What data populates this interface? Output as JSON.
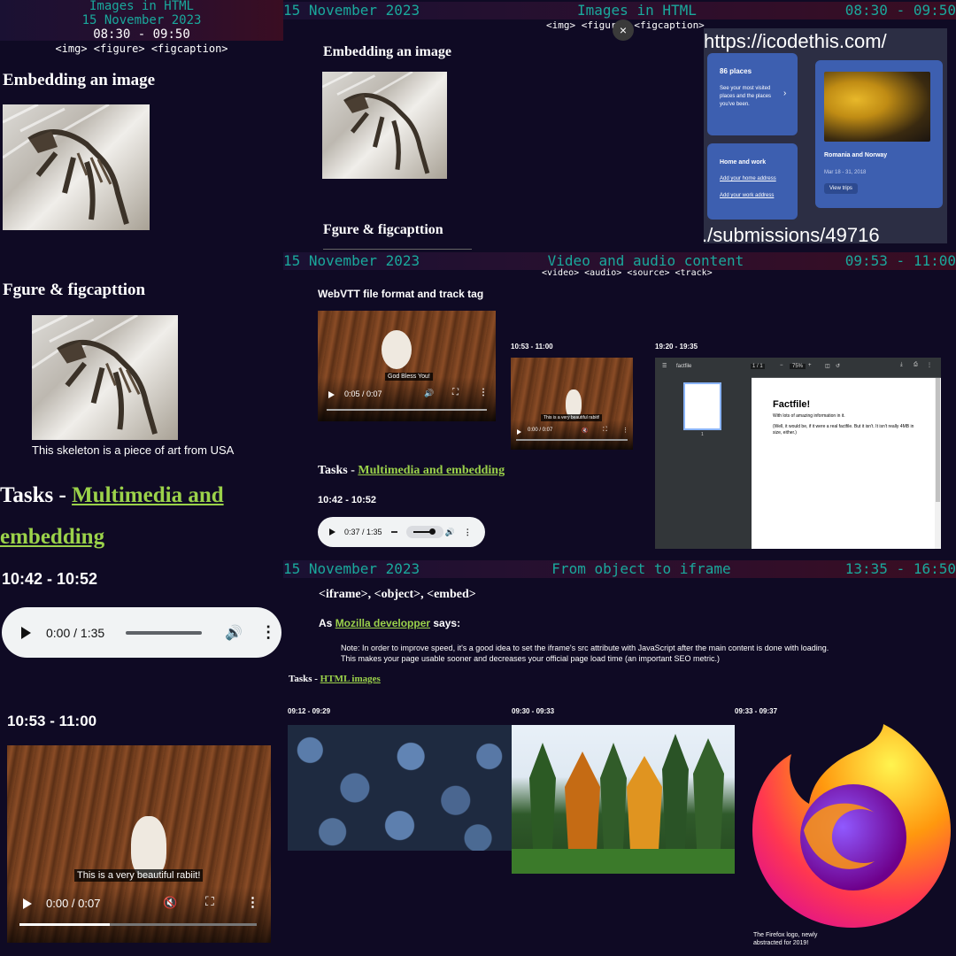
{
  "panel1": {
    "title": "Images in HTML",
    "date": "15 November 2023",
    "time": "08:30 - 09:50",
    "tags": "<img> <figure> <figcaption>",
    "h_embed": "Embedding an image",
    "h_figure": "Fgure & figcapttion",
    "figcaption": "This skeleton is a piece of art from USA",
    "tasks_prefix": "Tasks - ",
    "tasks_link": "Multimedia and embedding",
    "audio_time_heading": "10:42 - 10:52",
    "audio_time": "0:00 / 1:35",
    "video_time_heading": "10:53 - 11:00",
    "video_caption": "This is a very beautiful rabiit!",
    "video_time": "0:00 / 0:07"
  },
  "panel2": {
    "date": "15 November 2023",
    "title": "Images in HTML",
    "time": "08:30 - 09:50",
    "tags": "<img> <figure> <figcaption>",
    "h_embed": "Embedding an image",
    "h_figure": "Fgure & figcapttion",
    "close": "×"
  },
  "panel3": {
    "url": "https://icodethis.com/",
    "path": "./submissions/49716",
    "card1_title": "86 places",
    "card1_text": "See your most visited places and the places you've been.",
    "card2_title": "Home and work",
    "card2_link1": "Add your home address",
    "card2_link2": "Add your work address",
    "card3_title": "Romania and Norway",
    "card3_date": "Mar 18 - 31, 2018",
    "card3_button": "View trips",
    "card_color": "#3d5fb0"
  },
  "panel4": {
    "date": "15 November 2023",
    "title": "Video and audio content",
    "time": "09:53 - 11:00",
    "tags": "<video> <audio> <source> <track>",
    "h_webvtt": "WebVTT file format and track tag",
    "video1_caption": "God Bless You!",
    "video1_time": "0:05 / 0:07",
    "video2_heading": "10:53 - 11:00",
    "video2_caption": "This is a very beautiful rabiit!",
    "video2_time": "0:00 / 0:07",
    "pdf_heading": "19:20 - 19:35",
    "pdf_name": "factfile",
    "pdf_page": "1 / 1",
    "pdf_zoom": "75%",
    "pdf_thumb_num": "1",
    "pdf_title": "Factfile!",
    "pdf_line1": "With lots of amazing information in it.",
    "pdf_line2": "(Well, it would be, if it were a real factfile. But it isn't. It isn't really 4MB in size, either.)",
    "tasks_prefix": "Tasks - ",
    "tasks_link": "Multimedia and embedding",
    "audio_heading": "10:42 - 10:52",
    "audio_time": "0:37 / 1:35"
  },
  "panel5": {
    "date": "15 November 2023",
    "title": "From object to iframe",
    "time": "13:35 - 16:50",
    "h_tags": "<iframe>, <object>, <embed>",
    "as_prefix": "As ",
    "as_link": "Mozilla developper",
    "as_suffix": " says:",
    "note1": "Note: In order to improve speed, it's a good idea to set the iframe's src attribute with JavaScript after the main content is done with loading.",
    "note2": "This makes your page usable sooner and decreases your official page load time (an important SEO metric.)",
    "tasks_prefix": "Tasks - ",
    "tasks_link": "HTML images",
    "img1_time": "09:12 - 09:29",
    "img2_time": "09:30 - 09:33",
    "img3_time": "09:33 - 09:37",
    "logo_caption1": "The Firefox logo, newly",
    "logo_caption2": "abstracted for 2019!"
  }
}
